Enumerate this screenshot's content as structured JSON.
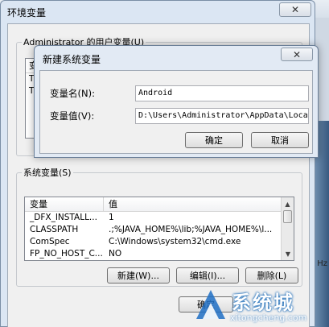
{
  "env_dialog": {
    "title": "环境变量",
    "user_group_label": "Administrator 的用户变量(U)",
    "user_list": {
      "header": "变",
      "rows": [
        "TE",
        "TM"
      ]
    },
    "system_group_label": "系统变量(S)",
    "system_list": {
      "headers": [
        "变量",
        "值"
      ],
      "rows": [
        {
          "name": "_DFX_INSTALL...",
          "value": "1"
        },
        {
          "name": "CLASSPATH",
          "value": ".;%JAVA_HOME%\\lib;%JAVA_HOME%\\l..."
        },
        {
          "name": "ComSpec",
          "value": "C:\\Windows\\system32\\cmd.exe"
        },
        {
          "name": "FP_NO_HOST_C...",
          "value": "NO"
        }
      ]
    },
    "buttons": {
      "new": "新建(W)...",
      "edit": "编辑(I)...",
      "delete": "删除(L)",
      "ok": "确定"
    },
    "close_glyph": "✕"
  },
  "new_var_dialog": {
    "title": "新建系统变量",
    "close_glyph": "✕",
    "name_label": "变量名(N):",
    "name_value": "Android",
    "value_label": "变量值(V):",
    "value_value": "D:\\Users\\Administrator\\AppData\\Local",
    "ok": "确定",
    "cancel": "取消"
  },
  "side_text": "Hz",
  "watermark": {
    "text": "系统城",
    "url": "xitongcheng.com"
  }
}
